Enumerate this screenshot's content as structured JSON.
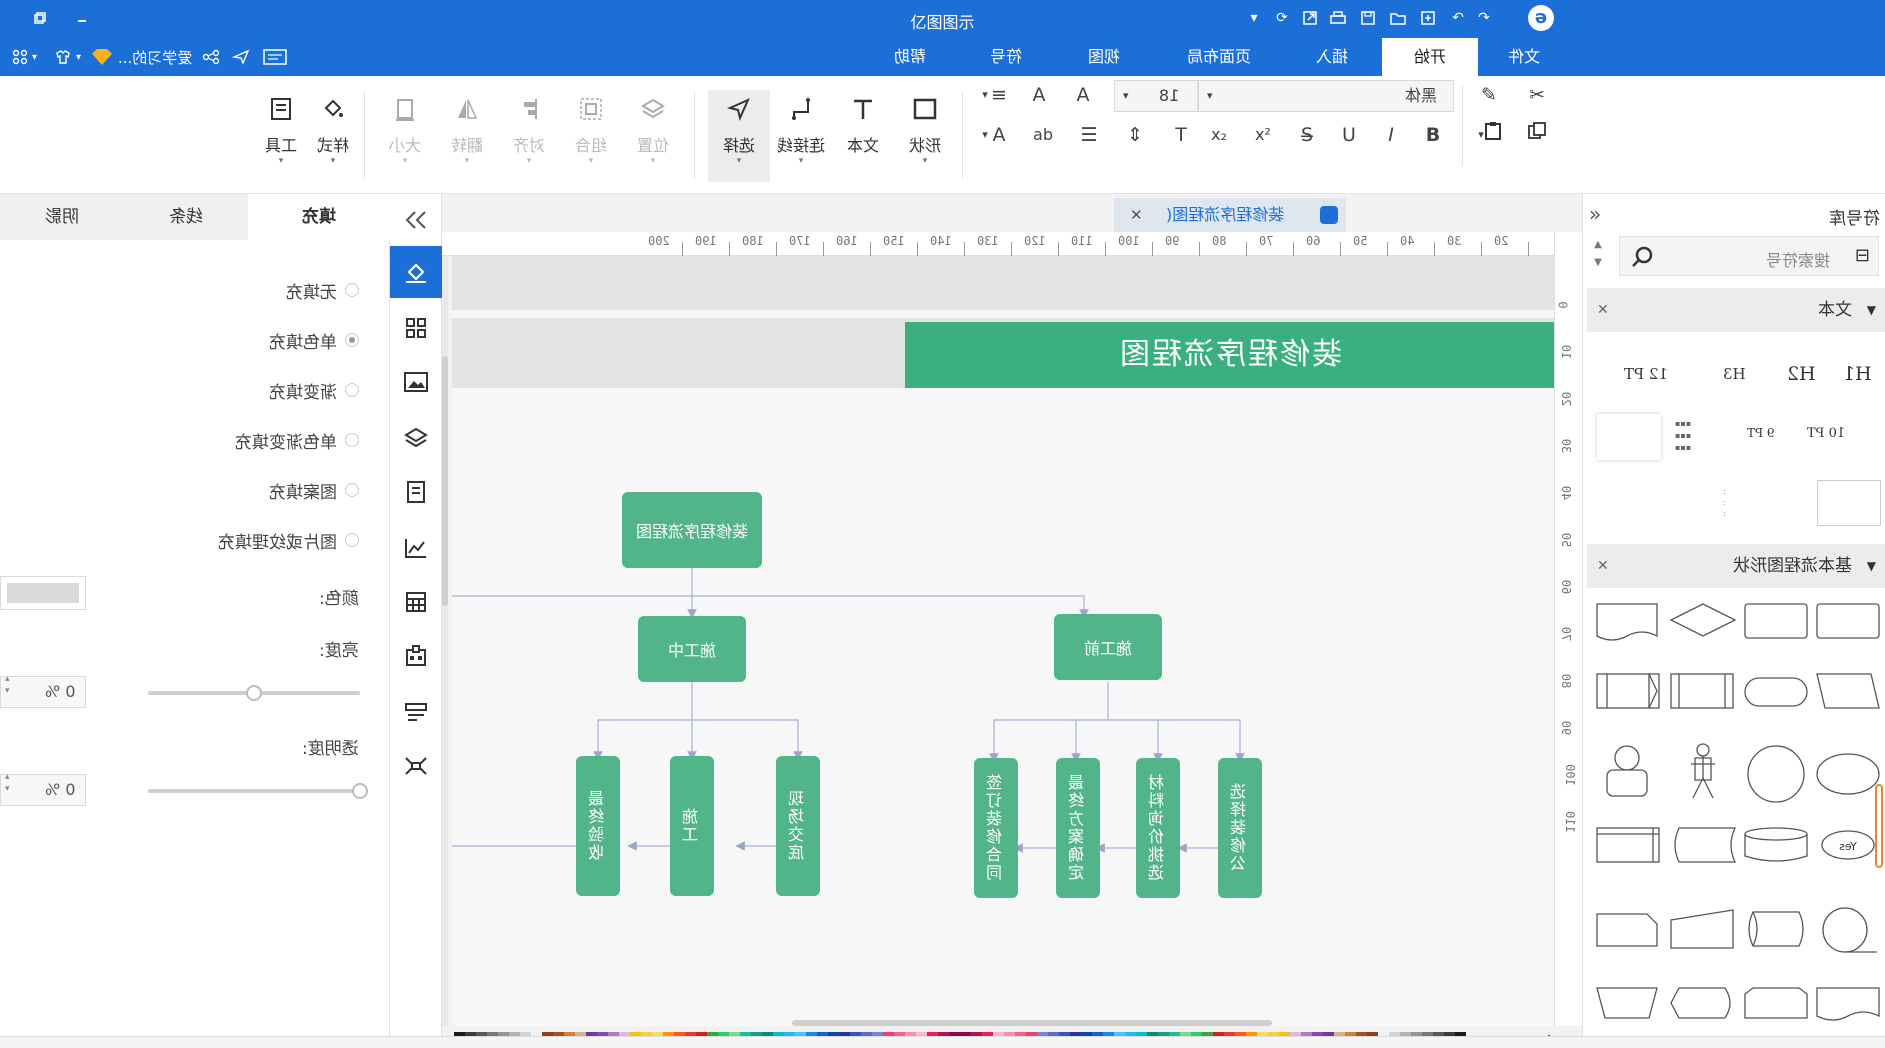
{
  "app": {
    "title": "亿图图示"
  },
  "titlebar": {
    "logo_icon": "edraw-logo-icon",
    "right_controls": [
      "minimize-icon",
      "restore-icon"
    ]
  },
  "menubar": {
    "tabs": [
      "文件",
      "开始",
      "插入",
      "页面布局",
      "视图",
      "符号",
      "帮助"
    ],
    "active_tab": "开始",
    "user_label": "爱学习的..."
  },
  "ribbon": {
    "font_name": "黑体",
    "font_size": "18",
    "tools": {
      "shape": "形状",
      "text": "文本",
      "connector": "连接线",
      "select": "选择"
    },
    "arrange": {
      "position": "位置",
      "group": "组合",
      "align": "对齐",
      "flip": "翻转",
      "size": "大小"
    },
    "style": "样式",
    "utilities": "工具"
  },
  "left_panel": {
    "tabs": [
      "填充",
      "线条",
      "阴影"
    ],
    "active_tab": "填充",
    "fill_options": [
      "无填充",
      "单色填充",
      "渐变填充",
      "单色渐变填充",
      "图案填充",
      "图片或纹理填充"
    ],
    "selected_fill": "单色填充",
    "color_label": "颜色:",
    "brightness_label": "亮度:",
    "brightness_value": "0 %",
    "brightness_level": 0.5,
    "transparency_label": "透明度:",
    "transparency_value": "0 %",
    "transparency_level": 1.0
  },
  "document": {
    "tab_title": "装修程序流程图(",
    "ruler_h": [
      "20",
      "30",
      "40",
      "50",
      "60",
      "70",
      "80",
      "90",
      "100",
      "110",
      "120",
      "130",
      "140",
      "150",
      "160",
      "170",
      "180",
      "190",
      "200"
    ],
    "ruler_v": [
      "0",
      "10",
      "20",
      "30",
      "40",
      "50",
      "60",
      "70",
      "80",
      "90",
      "100",
      "110"
    ],
    "banner_title": "装修程序流程图",
    "root_node": "装修程序流程图",
    "level2": {
      "left": "施工中",
      "right": "施工前"
    },
    "level3_left": [
      "现场交底",
      "施工",
      "最终验收"
    ],
    "level3_right": [
      "选择装修公",
      "材料询价挑选",
      "最终方案确定",
      "签订装修合同"
    ]
  },
  "right_panel": {
    "title": "符号库",
    "search_placeholder": "搜索符号",
    "section_text": "文本",
    "text_samples": [
      "H1",
      "H2",
      "H3",
      "12 PT",
      "10 PT",
      "9 PT"
    ],
    "section_flow": "基本流程图形状",
    "yes_label": "Yes"
  },
  "colors": {
    "brand": "#1b6fd6",
    "node": "#52b589",
    "banner": "#3bb07f",
    "palette": [
      "#1b1b1b",
      "#3b3b3b",
      "#5a5a5a",
      "#787878",
      "#969696",
      "#b4b4b4",
      "#d2d2d2",
      "#f0f0f0",
      "#8b4513",
      "#a0522d",
      "#cd853f",
      "#d2b48c",
      "#6a3d9a",
      "#8e44ad",
      "#b07cc6",
      "#d7bde2",
      "#f1c40f",
      "#f4d03f",
      "#f7dc6f",
      "#ff9800",
      "#ff5722",
      "#e53935",
      "#c62828",
      "#43a047",
      "#2ecc71",
      "#7bd88f",
      "#1abc9c",
      "#16a085",
      "#0e8a6e",
      "#00bcd4",
      "#29b6f6",
      "#4fc3f7",
      "#1e88e5",
      "#1565c0",
      "#0d47a1",
      "#283593",
      "#3f51b5",
      "#5c6bc0",
      "#7986cb",
      "#ec407a",
      "#f06292",
      "#f48fb1",
      "#f8bbd0",
      "#e91e63",
      "#ad1457",
      "#880e4f"
    ]
  }
}
